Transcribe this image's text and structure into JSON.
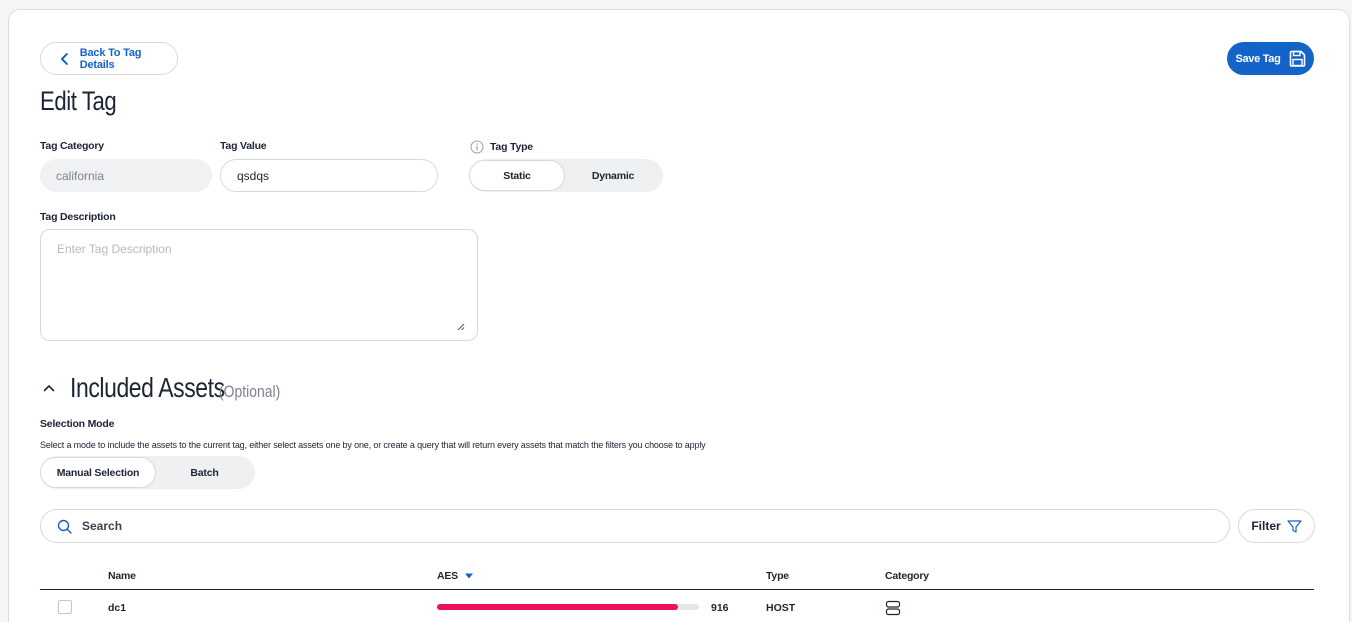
{
  "header": {
    "back_label": "Back To Tag Details",
    "save_label": "Save Tag",
    "title": "Edit Tag"
  },
  "form": {
    "category_label": "Tag Category",
    "category_value": "california",
    "value_label": "Tag Value",
    "value_value": "qsdqs",
    "type_label": "Tag Type",
    "type_options": [
      "Static",
      "Dynamic"
    ],
    "type_selected": "Static",
    "description_label": "Tag Description",
    "description_placeholder": "Enter Tag Description"
  },
  "assets": {
    "title": "Included Assets",
    "optional": "(Optional)",
    "mode_label": "Selection Mode",
    "mode_description": "Select a mode to include the assets to the current tag, either select assets one by one, or create a query that will return every assets that match the filters you choose to apply",
    "mode_options": [
      "Manual Selection",
      "Batch"
    ],
    "mode_selected": "Manual Selection",
    "search_placeholder": "Search",
    "filter_label": "Filter",
    "columns": [
      "Name",
      "AES",
      "Type",
      "Category"
    ],
    "rows": [
      {
        "name": "dc1",
        "aes": 916,
        "aes_fraction": 0.92,
        "type": "HOST",
        "category_icon": "server-icon"
      }
    ]
  },
  "colors": {
    "accent": "#1463c8",
    "aes_bar": "#ee1157"
  }
}
